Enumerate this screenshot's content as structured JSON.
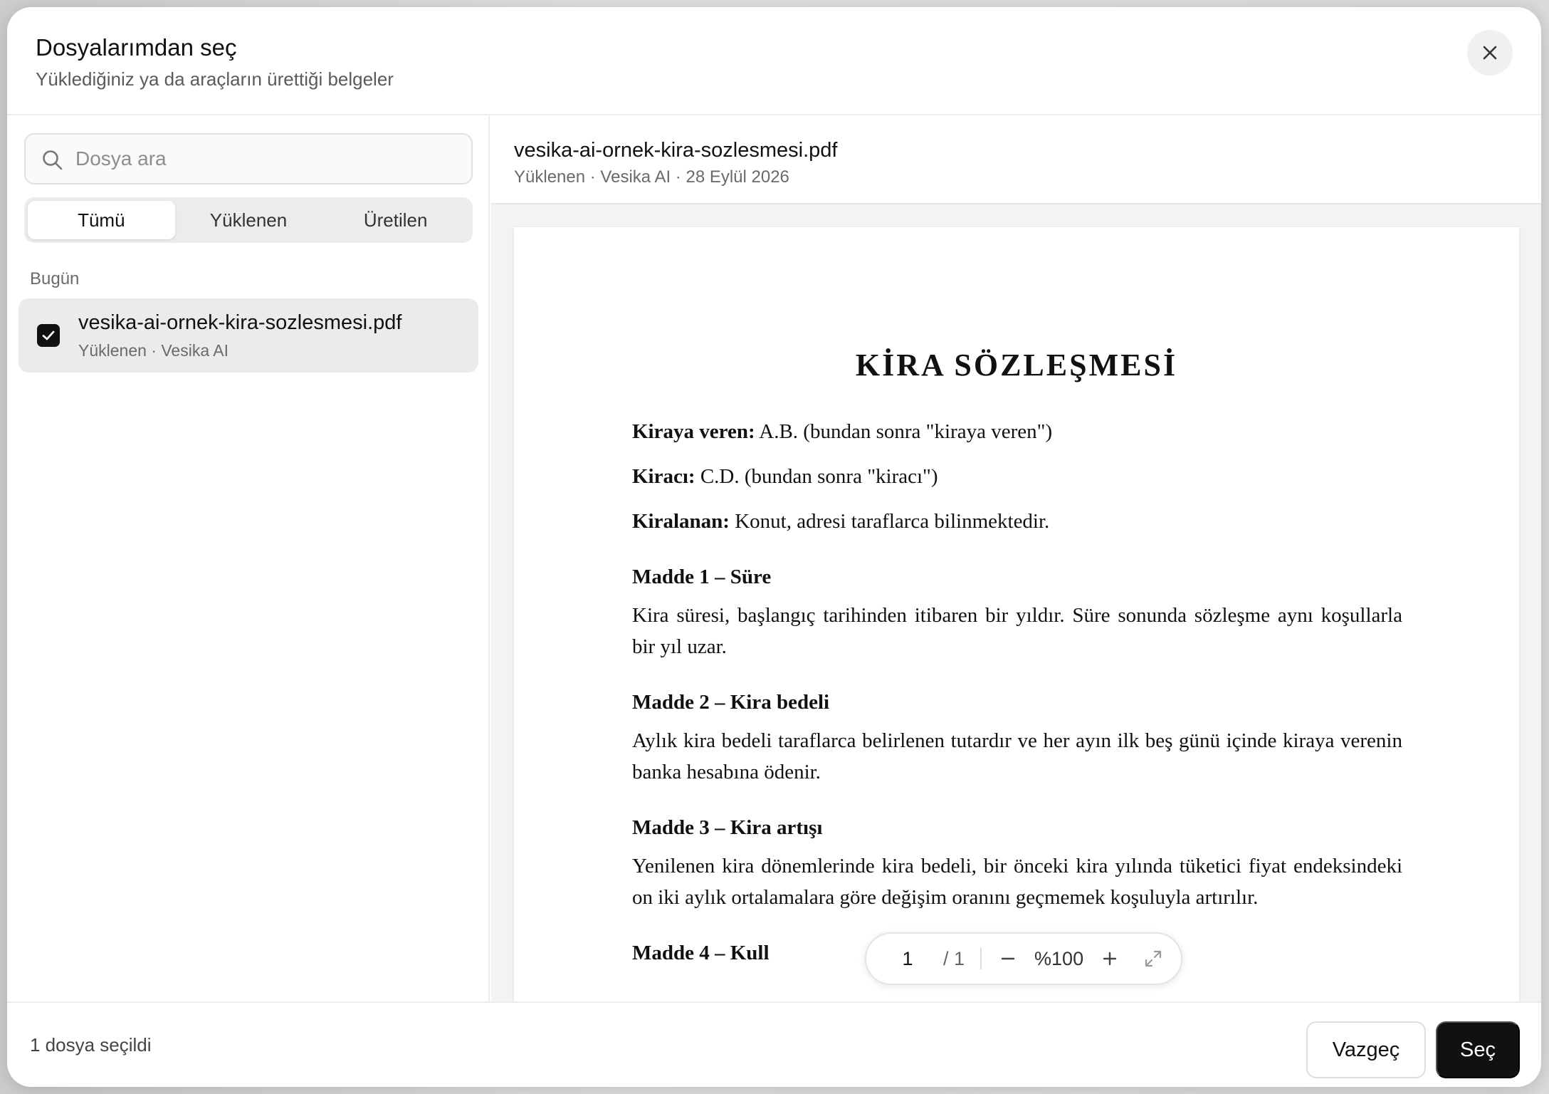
{
  "header": {
    "title": "Dosyalarımdan seç",
    "subtitle": "Yüklediğiniz ya da araçların ürettiği belgeler"
  },
  "search": {
    "placeholder": "Dosya ara",
    "value": ""
  },
  "tabs": [
    {
      "label": "Tümü",
      "active": true
    },
    {
      "label": "Yüklenen",
      "active": false
    },
    {
      "label": "Üretilen",
      "active": false
    }
  ],
  "groups": [
    {
      "label": "Bugün",
      "files": [
        {
          "name": "vesika-ai-ornek-kira-sozlesmesi.pdf",
          "meta": "Yüklenen · Vesika AI",
          "checked": true
        }
      ]
    }
  ],
  "preview": {
    "file_name": "vesika-ai-ornek-kira-sozlesmesi.pdf",
    "meta": "Yüklenen · Vesika AI · 28 Eylül 2026",
    "document": {
      "title": "KİRA SÖZLEŞMESİ",
      "parties": [
        {
          "label": "Kiraya veren:",
          "text": " A.B. (bundan sonra \"kiraya veren\")"
        },
        {
          "label": "Kiracı:",
          "text": " C.D. (bundan sonra \"kiracı\")"
        },
        {
          "label": "Kiralanan:",
          "text": " Konut, adresi taraflarca bilinmektedir."
        }
      ],
      "articles": [
        {
          "title": "Madde 1 – Süre",
          "text": "Kira süresi, başlangıç tarihinden itibaren bir yıldır. Süre sonunda sözleşme aynı koşullarla bir yıl uzar."
        },
        {
          "title": "Madde 2 – Kira bedeli",
          "text": "Aylık kira bedeli taraflarca belirlenen tutardır ve her ayın ilk beş günü içinde kiraya verenin banka hesabına ödenir."
        },
        {
          "title": "Madde 3 – Kira artışı",
          "text": "Yenilenen kira dönemlerinde kira bedeli, bir önceki kira yılında tüketici fiyat endeksindeki on iki aylık ortalamalara göre değişim oranını geçmemek koşuluyla artırılır."
        },
        {
          "title": "Madde 4 – Kull",
          "text": ""
        }
      ]
    },
    "toolbar": {
      "page": "1",
      "total": "/ 1",
      "zoom": "%100",
      "zoom_out_icon": "minus-icon",
      "zoom_in_icon": "plus-icon",
      "fit_icon": "expand-icon"
    }
  },
  "footer": {
    "selection_count": "1 dosya seçildi",
    "cancel_label": "Vazgeç",
    "select_label": "Seç"
  },
  "colors": {
    "primary_button": "#111111",
    "selected_item_bg": "#ebebeb"
  }
}
